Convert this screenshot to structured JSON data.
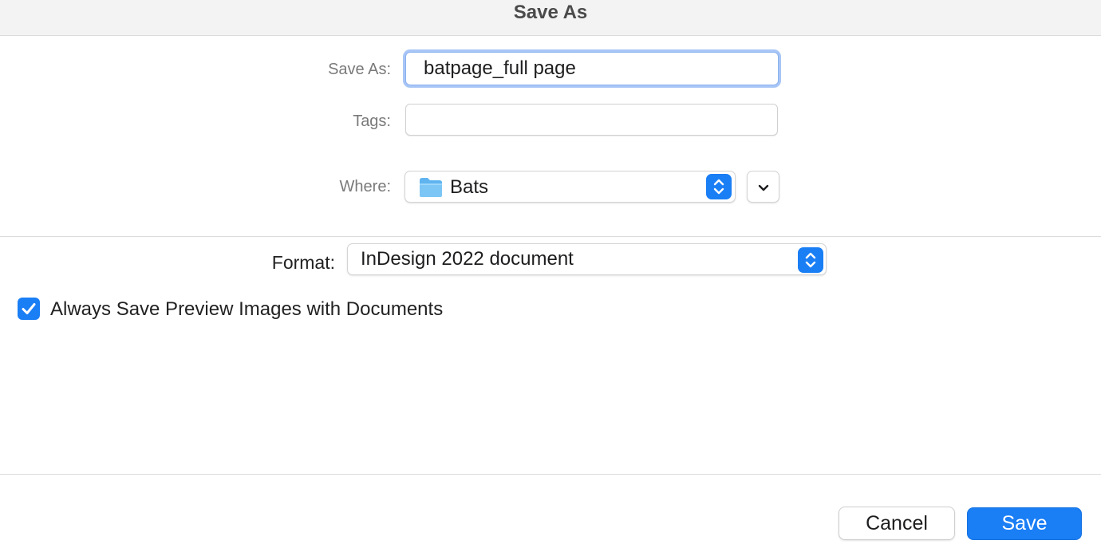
{
  "window": {
    "title": "Save As"
  },
  "form": {
    "save_as_label": "Save As:",
    "save_as_value": "batpage_full page",
    "tags_label": "Tags:",
    "tags_value": "",
    "where_label": "Where:",
    "where_value": "Bats",
    "where_icon": "folder-icon",
    "expand_icon": "chevron-down-icon"
  },
  "options": {
    "format_label": "Format:",
    "format_value": "InDesign 2022 document",
    "preview_checkbox_label": "Always Save Preview Images with Documents",
    "preview_checked": true
  },
  "buttons": {
    "cancel_label": "Cancel",
    "save_label": "Save"
  },
  "colors": {
    "accent": "#1a7ef5",
    "focus_ring": "#a8c6f6"
  }
}
